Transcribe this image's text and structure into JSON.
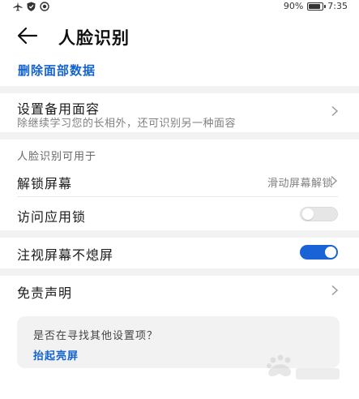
{
  "status_bar": {
    "icons": [
      "airplane-icon",
      "shield-icon",
      "location-icon"
    ],
    "battery_percent": "90%",
    "battery_level": 0.9,
    "time": "7:35"
  },
  "header": {
    "title": "人脸识别",
    "back_icon": "arrow-left-icon"
  },
  "delete_link": "删除面部数据",
  "backup_face": {
    "title": "设置备用面容",
    "subtitle": "除继续学习您的长相外，还可识别另一种面容"
  },
  "usage_section": {
    "label": "人脸识别可用于",
    "items": [
      {
        "title": "解锁屏幕",
        "value": "滑动屏幕解锁"
      },
      {
        "title": "访问应用锁",
        "toggle": false
      }
    ]
  },
  "gaze_setting": {
    "title": "注视屏幕不熄屏",
    "toggle": true
  },
  "disclaimer": {
    "title": "免责声明"
  },
  "suggestion": {
    "question": "是否在寻找其他设置项？",
    "link": "抬起亮屏"
  },
  "colors": {
    "accent": "#1363cf",
    "toggle_on": "#1a63d6",
    "divider": "#f2f2f2"
  }
}
